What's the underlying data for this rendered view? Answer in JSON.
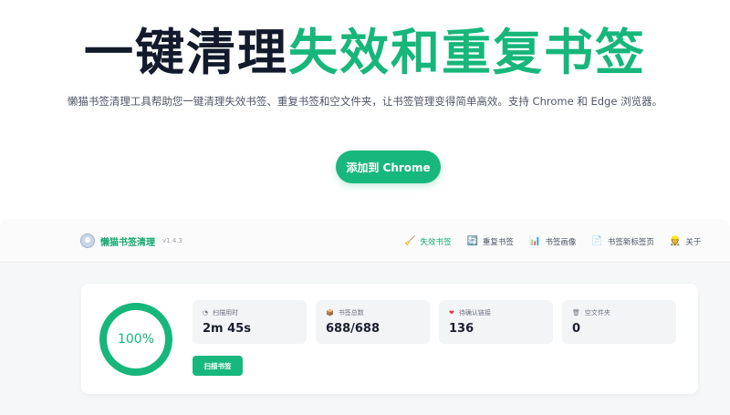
{
  "hero": {
    "title_dark": "一键清理",
    "title_green": "失效和重复书签",
    "subtitle": "懒猫书签清理工具帮助您一键清理失效书签、重复书签和空文件夹，让书签管理变得简单高效。支持 Chrome 和 Edge 浏览器。",
    "cta_label": "添加到 Chrome",
    "accent_color": "#17b67b"
  },
  "app": {
    "brand": {
      "name": "懒猫书签清理",
      "version": "v1.4.3"
    },
    "nav": [
      {
        "icon": "broom-icon",
        "glyph": "🧹",
        "label": "失效书签",
        "active": true
      },
      {
        "icon": "refresh-icon",
        "glyph": "🔄",
        "label": "重复书签",
        "active": false
      },
      {
        "icon": "bar-chart-icon",
        "glyph": "📊",
        "label": "书签画像",
        "active": false
      },
      {
        "icon": "document-icon",
        "glyph": "📄",
        "label": "书签新标签页",
        "active": false
      },
      {
        "icon": "person-icon",
        "glyph": "👷",
        "label": "关于",
        "active": false
      }
    ],
    "progress": {
      "value": 100,
      "label": "100%"
    },
    "stats": [
      {
        "icon": "clock-icon",
        "glyph": "◔",
        "label": "扫描用时",
        "value": "2m 45s"
      },
      {
        "icon": "bookmark-box-icon",
        "glyph": "📦",
        "label": "书签总数",
        "value": "688/688"
      },
      {
        "icon": "heart-icon",
        "glyph": "❤",
        "label": "待确认链接",
        "value": "136"
      },
      {
        "icon": "trash-icon",
        "glyph": "🗑",
        "label": "空文件夹",
        "value": "0"
      }
    ],
    "scan_button": "扫描书签"
  }
}
